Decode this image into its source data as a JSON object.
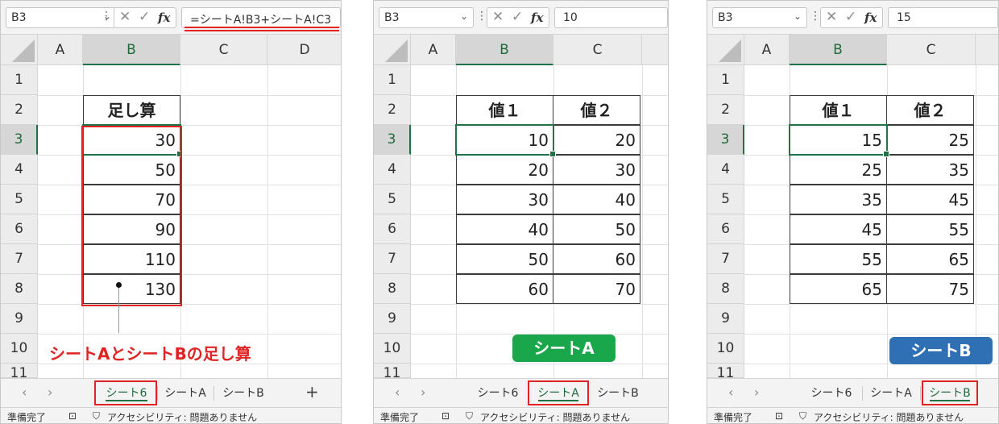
{
  "colors": {
    "accent": "#217346",
    "highlight": "#e02424",
    "sheet_a_badge": "#1aa64a",
    "sheet_b_badge": "#2f6fb3"
  },
  "row_numbers": [
    "1",
    "2",
    "3",
    "4",
    "5",
    "6",
    "7",
    "8",
    "9",
    "10",
    "11"
  ],
  "status_bar": {
    "ready": "準備完了",
    "accessibility": "アクセシビリティ: 問題ありません"
  },
  "panels": [
    {
      "name_box": "B3",
      "formula": "=シートA!B3+シートA!C3",
      "columns": [
        "A",
        "B",
        "C",
        "D"
      ],
      "table_header": [
        "足し算"
      ],
      "table_rows": [
        [
          "30"
        ],
        [
          "50"
        ],
        [
          "70"
        ],
        [
          "90"
        ],
        [
          "110"
        ],
        [
          "130"
        ]
      ],
      "callout": "シートAとシートBの足し算",
      "tabs": [
        "シート6",
        "シートA",
        "シートB"
      ],
      "active_tab": 0
    },
    {
      "name_box": "B3",
      "formula": "10",
      "columns": [
        "A",
        "B",
        "C"
      ],
      "table_header": [
        "値１",
        "値２"
      ],
      "table_rows": [
        [
          "10",
          "20"
        ],
        [
          "20",
          "30"
        ],
        [
          "30",
          "40"
        ],
        [
          "40",
          "50"
        ],
        [
          "50",
          "60"
        ],
        [
          "60",
          "70"
        ]
      ],
      "badge": "シートA",
      "tabs": [
        "シート6",
        "シートA",
        "シートB"
      ],
      "active_tab": 1
    },
    {
      "name_box": "B3",
      "formula": "15",
      "columns": [
        "A",
        "B",
        "C"
      ],
      "table_header": [
        "値１",
        "値２"
      ],
      "table_rows": [
        [
          "15",
          "25"
        ],
        [
          "25",
          "35"
        ],
        [
          "35",
          "45"
        ],
        [
          "45",
          "55"
        ],
        [
          "55",
          "65"
        ],
        [
          "65",
          "75"
        ]
      ],
      "badge": "シートB",
      "tabs": [
        "シート6",
        "シートA",
        "シートB"
      ],
      "active_tab": 2
    }
  ]
}
